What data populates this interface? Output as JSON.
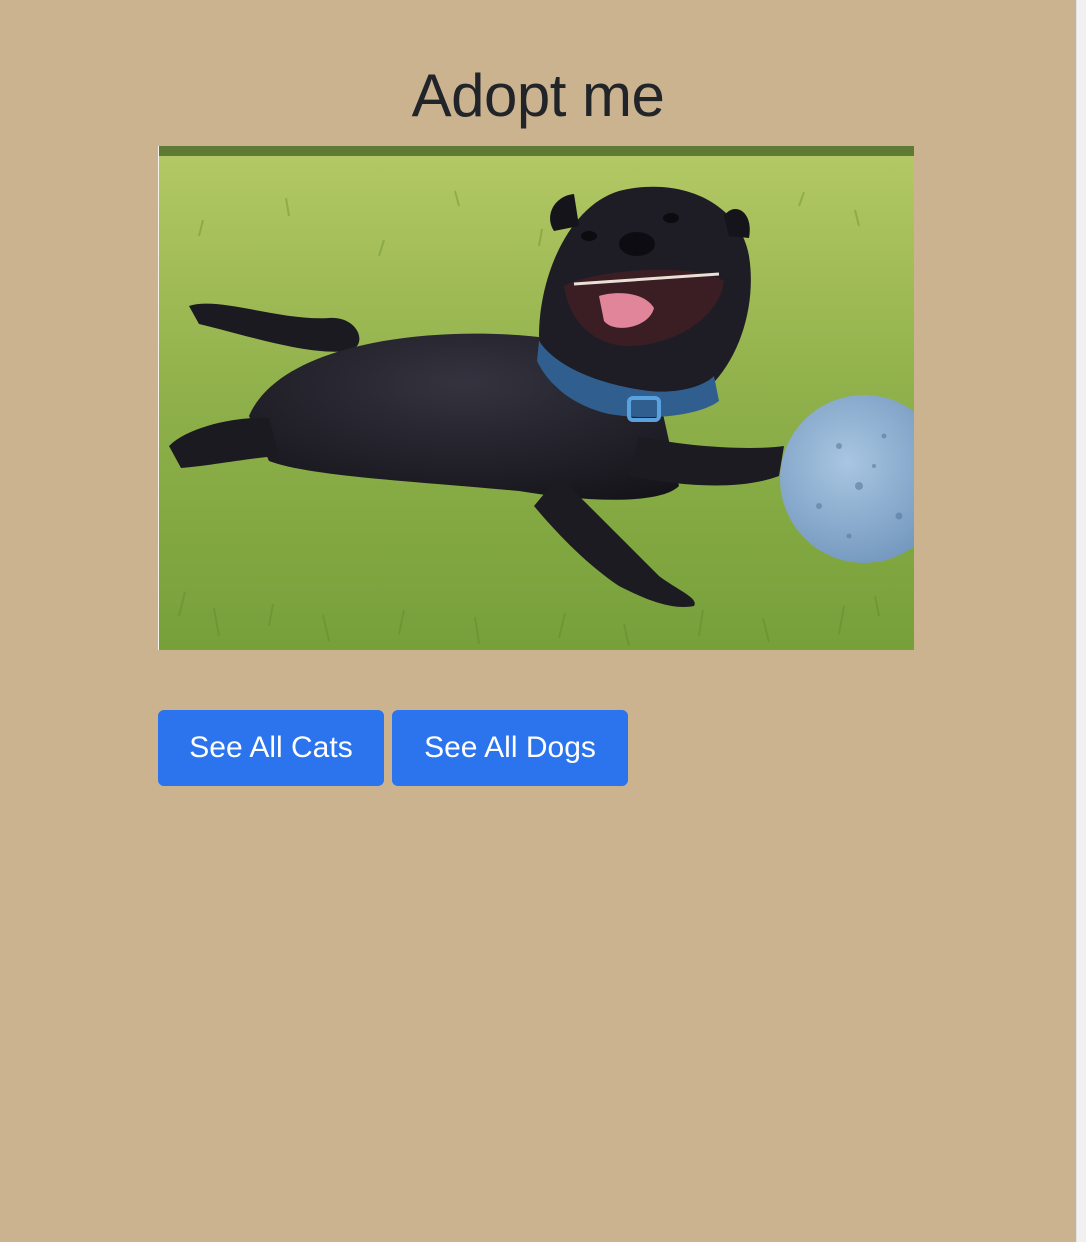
{
  "page": {
    "title": "Adopt me",
    "background_color": "#ccb390"
  },
  "hero_image": {
    "subject": "dog-photo",
    "colors": {
      "grass_light": "#a9c35a",
      "grass_dark": "#6f9533",
      "dog": "#1c1b22",
      "dog_highlight": "#3a3946",
      "collar": "#3a77b8",
      "tongue": "#e0859a",
      "ball": "#8db0d3"
    }
  },
  "buttons": {
    "cats_label": "See All Cats",
    "dogs_label": "See All Dogs",
    "color": "#2b74ee"
  },
  "icons": {
    "scrollbar": "scrollbar-track"
  }
}
